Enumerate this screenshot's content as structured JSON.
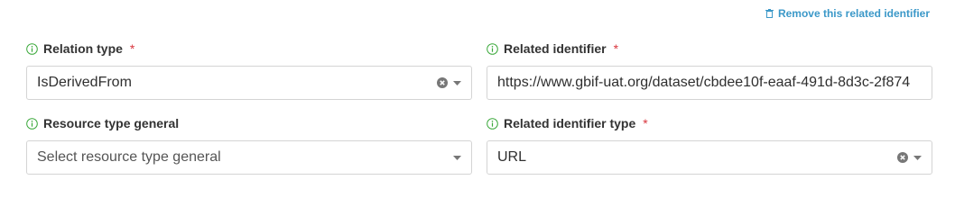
{
  "remove_link": {
    "label": "Remove this related identifier",
    "icon": "trash-icon",
    "color": "#3b98c8"
  },
  "fields": {
    "relation_type": {
      "label": "Relation type",
      "required_mark": "*",
      "value": "IsDerivedFrom",
      "icon": "info-icon"
    },
    "related_identifier": {
      "label": "Related identifier",
      "required_mark": "*",
      "value": "https://www.gbif-uat.org/dataset/cbdee10f-eaaf-491d-8d3c-2f874",
      "icon": "info-icon"
    },
    "resource_type_general": {
      "label": "Resource type general",
      "placeholder": "Select resource type general",
      "icon": "info-icon"
    },
    "related_identifier_type": {
      "label": "Related identifier type",
      "required_mark": "*",
      "value": "URL",
      "icon": "info-icon"
    }
  },
  "colors": {
    "info_icon": "#3aa83a",
    "required": "#d9363e",
    "border": "#d4d4d4"
  }
}
